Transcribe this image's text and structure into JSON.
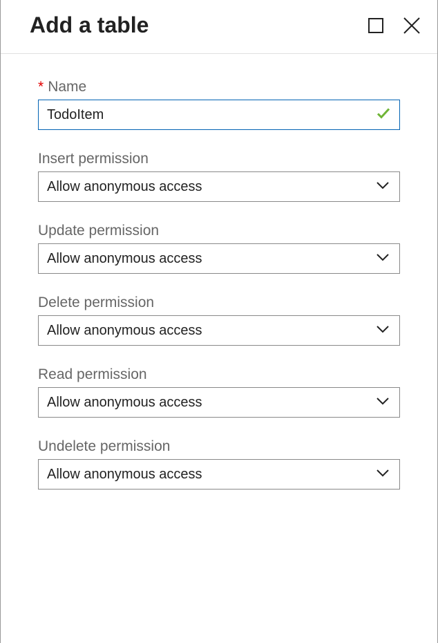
{
  "header": {
    "title": "Add a table"
  },
  "form": {
    "name": {
      "label": "Name",
      "required": true,
      "value": "TodoItem",
      "valid": true
    },
    "permissions": [
      {
        "label": "Insert permission",
        "value": "Allow anonymous access"
      },
      {
        "label": "Update permission",
        "value": "Allow anonymous access"
      },
      {
        "label": "Delete permission",
        "value": "Allow anonymous access"
      },
      {
        "label": "Read permission",
        "value": "Allow anonymous access"
      },
      {
        "label": "Undelete permission",
        "value": "Allow anonymous access"
      }
    ]
  }
}
